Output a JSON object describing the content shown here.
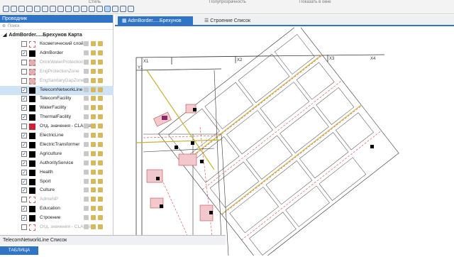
{
  "ribbon": {
    "group_labels": [
      "Стиль",
      "Полупрозрачность",
      "Показать в окне"
    ]
  },
  "tabs": [
    {
      "label": "AdmBorder.....Брехунов Карта"
    },
    {
      "label": "Строение Список"
    }
  ],
  "catalog": {
    "title": "Проводник",
    "search_placeholder": "Поиск",
    "map_name": "AdmBorder.....Брехунов Карта",
    "layers": [
      {
        "label": "Косметический слой",
        "checked": false,
        "grey": false
      },
      {
        "label": "AdmBorder",
        "checked": true,
        "grey": false
      },
      {
        "label": "DrinkWaterProtection",
        "checked": false,
        "grey": true
      },
      {
        "label": "EngProtectionZone",
        "checked": false,
        "grey": true
      },
      {
        "label": "EngSanitaryGapZone",
        "checked": false,
        "grey": true
      },
      {
        "label": "TelecomNetworkLine",
        "checked": true,
        "grey": false,
        "selected": true
      },
      {
        "label": "TelecomFacility",
        "checked": true,
        "grey": false
      },
      {
        "label": "WaterFacility",
        "checked": true,
        "grey": false
      },
      {
        "label": "ThermalFacility",
        "checked": true,
        "grey": false
      },
      {
        "label": "Отд. значения - CLASSID",
        "checked": false,
        "grey": false
      },
      {
        "label": "ElectricLine",
        "checked": true,
        "grey": false
      },
      {
        "label": "ElectricTransformer",
        "checked": true,
        "grey": false
      },
      {
        "label": "Agriculture",
        "checked": true,
        "grey": false
      },
      {
        "label": "AuthorityService",
        "checked": true,
        "grey": false
      },
      {
        "label": "Health",
        "checked": true,
        "grey": false
      },
      {
        "label": "Sport",
        "checked": true,
        "grey": false
      },
      {
        "label": "Culture",
        "checked": true,
        "grey": false
      },
      {
        "label": "AdmeNP",
        "checked": false,
        "grey": true
      },
      {
        "label": "Education",
        "checked": true,
        "grey": false
      },
      {
        "label": "Строение",
        "checked": true,
        "grey": false,
        "bold": true
      },
      {
        "label": "Отд. значения - CLASSID",
        "checked": false,
        "grey": true
      }
    ]
  },
  "bottom_panel": {
    "title": "TelecomNetworkLine Список",
    "tab_label": "ТАБЛИЦА"
  },
  "map_labels": [
    "X1",
    "X2",
    "X3",
    "X4",
    "Y1"
  ]
}
